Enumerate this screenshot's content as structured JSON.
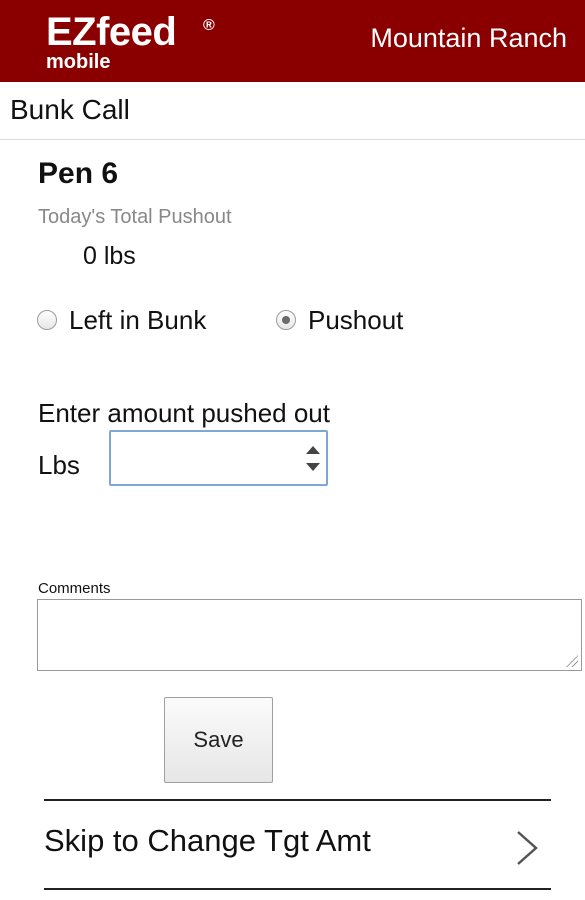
{
  "header": {
    "logo_main": "EZfeed",
    "logo_reg": "®",
    "logo_sub": "mobile",
    "ranch": "Mountain Ranch",
    "bg_color": "#8a0000"
  },
  "subheader": {
    "title": "Bunk Call"
  },
  "pen": {
    "title": "Pen 6",
    "total_label": "Today's Total Pushout",
    "total_value": "0 lbs"
  },
  "radios": {
    "left_label": "Left in Bunk",
    "pushout_label": "Pushout",
    "selected": "Pushout"
  },
  "form": {
    "enter_label": "Enter amount pushed out",
    "lbs_label": "Lbs",
    "lbs_value": "",
    "comments_label": "Comments",
    "comments_value": "",
    "save_label": "Save"
  },
  "footer": {
    "skip_label": "Skip to Change Tgt Amt",
    "chevron_icon": "chevron-right-icon"
  }
}
